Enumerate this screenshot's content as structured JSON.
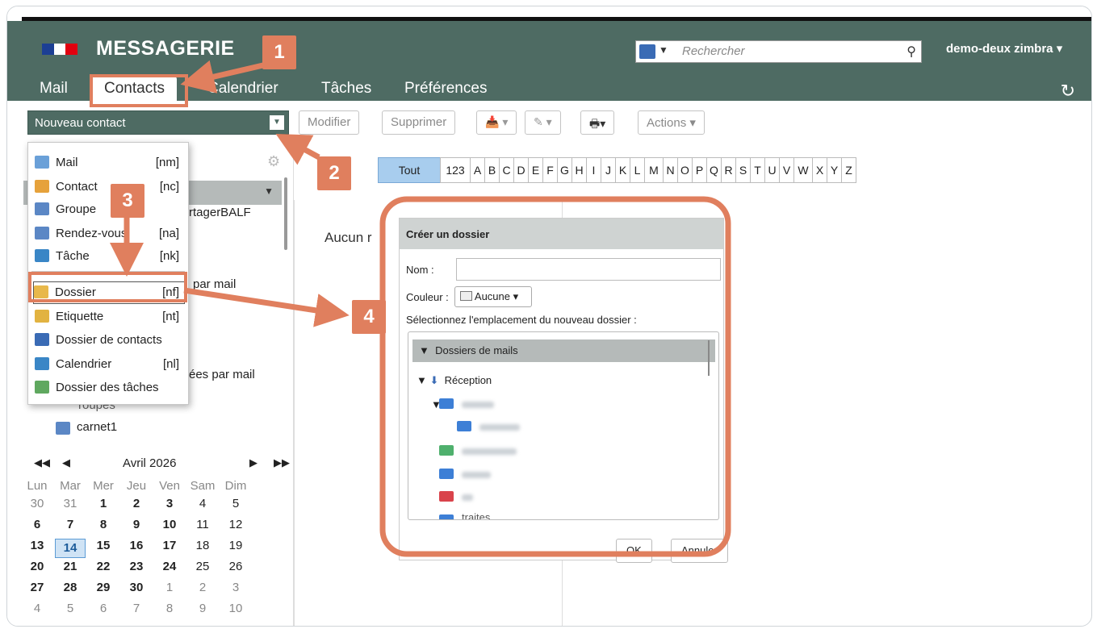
{
  "app": {
    "title": "MESSAGERIE",
    "user": "demo-deux zimbra",
    "search_placeholder": "Rechercher",
    "tabs": [
      "Mail",
      "Contacts",
      "Calendrier",
      "Tâches",
      "Préférences"
    ]
  },
  "toolbar": {
    "new_label": "Nouveau contact",
    "modify": "Modifier",
    "delete": "Supprimer",
    "actions": "Actions"
  },
  "menu": {
    "items": [
      {
        "label": "Mail",
        "shortcut": "[nm]",
        "icon": "mail-icon"
      },
      {
        "label": "Contact",
        "shortcut": "[nc]",
        "icon": "contact-icon"
      },
      {
        "label": "Groupe",
        "shortcut": "",
        "icon": "group-icon"
      },
      {
        "label": "Rendez-vous",
        "shortcut": "[na]",
        "icon": "appointment-icon"
      },
      {
        "label": "Tâche",
        "shortcut": "[nk]",
        "icon": "task-icon"
      },
      {
        "label": "Dossier",
        "shortcut": "[nf]",
        "icon": "folder-icon"
      },
      {
        "label": "Etiquette",
        "shortcut": "[nt]",
        "icon": "tag-icon"
      },
      {
        "label": "Dossier de contacts",
        "shortcut": "",
        "icon": "contacts-folder-icon"
      },
      {
        "label": "Calendrier",
        "shortcut": "[nl]",
        "icon": "calendar-icon"
      },
      {
        "label": "Dossier des tâches",
        "shortcut": "",
        "icon": "tasks-folder-icon"
      }
    ]
  },
  "sidebar": {
    "partial_1": "rtagerBALF",
    "partial_2": "par mail",
    "partial_3": "ées par mail",
    "partial_4": "roupes",
    "carnet": "carnet1"
  },
  "calendar": {
    "month": "Avril 2026",
    "weekdays": [
      "Lun",
      "Mar",
      "Mer",
      "Jeu",
      "Ven",
      "Sam",
      "Dim"
    ],
    "weeks": [
      [
        "30",
        "31",
        "1",
        "2",
        "3",
        "4",
        "5"
      ],
      [
        "6",
        "7",
        "8",
        "9",
        "10",
        "11",
        "12"
      ],
      [
        "13",
        "14",
        "15",
        "16",
        "17",
        "18",
        "19"
      ],
      [
        "20",
        "21",
        "22",
        "23",
        "24",
        "25",
        "26"
      ],
      [
        "27",
        "28",
        "29",
        "30",
        "1",
        "2",
        "3"
      ],
      [
        "4",
        "5",
        "6",
        "7",
        "8",
        "9",
        "10"
      ]
    ],
    "today": "14"
  },
  "alphabet": [
    "Tout",
    "123",
    "A",
    "B",
    "C",
    "D",
    "E",
    "F",
    "G",
    "H",
    "I",
    "J",
    "K",
    "L",
    "M",
    "N",
    "O",
    "P",
    "Q",
    "R",
    "S",
    "T",
    "U",
    "V",
    "W",
    "X",
    "Y",
    "Z"
  ],
  "content": {
    "empty_partial": "Aucun r"
  },
  "dialog": {
    "title": "Créer un dossier",
    "name_label": "Nom :",
    "color_label": "Couleur :",
    "color_value": "Aucune",
    "location_label": "Sélectionnez l'emplacement du nouveau dossier :",
    "tree_header": "Dossiers de mails",
    "inbox": "Réception",
    "last_partial": "traites",
    "ok_partial": "OK",
    "cancel_partial": "Annuler"
  },
  "badges": [
    "1",
    "2",
    "3",
    "4"
  ],
  "colors": {
    "header": "#4e6b63",
    "accent": "#e07f5e",
    "highlight": "#a8cdee"
  }
}
